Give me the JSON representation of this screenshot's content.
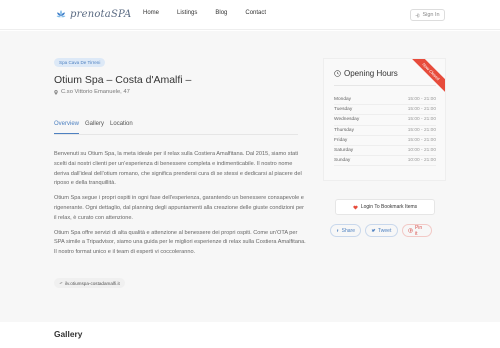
{
  "header": {
    "logo_text": "prenotaSPA",
    "nav": [
      "Home",
      "Listings",
      "Blog",
      "Contact"
    ],
    "signin_label": "Sign In"
  },
  "listing": {
    "category_badge": "Spa Cava De Tirreni",
    "title": "Otium Spa – Costa d'Amalfi –",
    "address": "C.so Vittorio Emanuele, 47",
    "tabs": [
      "Overview",
      "Gallery",
      "Location"
    ],
    "description": [
      "Benvenuti su Otium Spa, la meta ideale per il relax sulla Costiera Amalfitana. Dal 2015, siamo stati scelti dai nostri clienti per un'esperienza di benessere completa e indimenticabile. Il nostro nome deriva dall'ideal dell'otium romano, che significa prendersi cura di se stessi e dedicarsi al piacere del riposo e della tranquillità.",
      "Otium Spa segue i propri ospiti in ogni fase dell'esperienza, garantendo un benessere consapevole e rigenerante. Ogni dettaglio, dal planning degli appuntamenti alla creazione delle giuste condizioni per il relax, è curato con attenzione.",
      "Otium Spa offre servizi di alta qualità e attenzione al benessere dei propri ospiti. Come un'OTA per SPA simile a Tripadvisor, siamo una guida per le migliori esperienze di relax sulla Costiera Amalfitana. Il nostro format unico e il team di esperti vi coccoleranno."
    ],
    "link": "ilv.otiumspa-costadamalfi.it",
    "gallery_heading": "Gallery"
  },
  "hours": {
    "heading": "Opening Hours",
    "ribbon": "Now Closed",
    "days": [
      {
        "day": "Monday",
        "time": "15:00 - 21:00"
      },
      {
        "day": "Tuesday",
        "time": "15:00 - 21:00"
      },
      {
        "day": "Wednesday",
        "time": "15:00 - 21:00"
      },
      {
        "day": "Thursday",
        "time": "15:00 - 21:00"
      },
      {
        "day": "Friday",
        "time": "15:00 - 21:00"
      },
      {
        "day": "Saturday",
        "time": "10:00 - 21:00"
      },
      {
        "day": "Sunday",
        "time": "10:00 - 21:00"
      }
    ]
  },
  "actions": {
    "bookmark_label": "Login To Bookmark Items",
    "share": [
      "Share",
      "Tweet",
      "Pin it"
    ]
  },
  "colors": {
    "accent": "#4e81c1",
    "ribbon": "#e74c3c",
    "heart": "#e74c3c"
  }
}
